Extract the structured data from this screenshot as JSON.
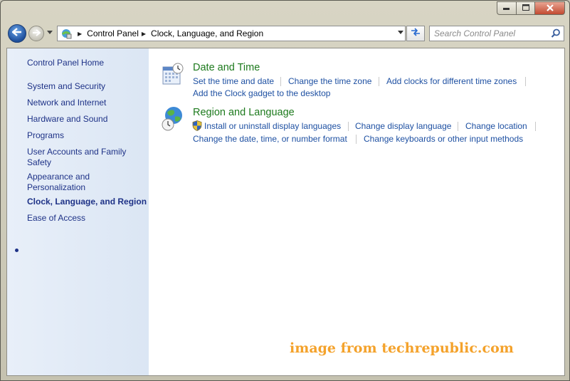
{
  "window": {
    "caption_buttons": {
      "minimize_icon": "minimize-icon",
      "maximize_icon": "maximize-icon",
      "close_icon": "close-icon"
    }
  },
  "nav": {
    "back_icon": "back-arrow-icon",
    "forward_icon": "forward-arrow-icon"
  },
  "address": {
    "crumbs": [
      "Control Panel",
      "Clock, Language, and Region"
    ]
  },
  "search": {
    "placeholder": "Search Control Panel"
  },
  "sidebar": {
    "items": [
      {
        "label": "Control Panel Home"
      },
      {
        "label": "System and Security"
      },
      {
        "label": "Network and Internet"
      },
      {
        "label": "Hardware and Sound"
      },
      {
        "label": "Programs"
      },
      {
        "label": "User Accounts and Family",
        "label2": "Safety"
      },
      {
        "label": "Appearance and",
        "label2": "Personalization"
      },
      {
        "label": "Clock, Language, and Region",
        "active": true
      },
      {
        "label": "Ease of Access"
      }
    ]
  },
  "categories": [
    {
      "title": "Date and Time",
      "icon": "calendar-clock-icon",
      "links": [
        "Set the time and date",
        "Change the time zone",
        "Add clocks for different time zones",
        "Add the Clock gadget to the desktop"
      ]
    },
    {
      "title": "Region and Language",
      "icon": "globe-clock-icon",
      "links": [
        "Install or uninstall display languages",
        "Change display language",
        "Change location",
        "Change the date, time, or number format",
        "Change keyboards or other input methods"
      ],
      "shield_icon": "uac-shield-icon"
    }
  ],
  "watermark": "image from techrepublic.com",
  "colors": {
    "link": "#1e50a2",
    "category_title": "#1d7a1d",
    "sidebar_text": "#1e3287",
    "watermark": "#f4a22b"
  }
}
